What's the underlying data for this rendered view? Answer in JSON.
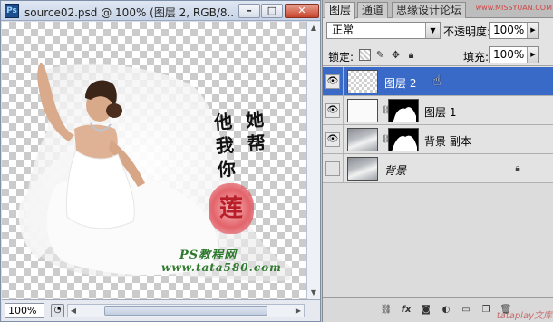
{
  "document": {
    "app_icon_text": "Ps",
    "title": "source02.psd @ 100% (图层 2, RGB/8...",
    "zoom_value": "100%"
  },
  "canvas_art": {
    "calligraphy_lines": [
      "他 她",
      "我 帮",
      "你"
    ],
    "seal_text": "莲",
    "brand_line": "PS教程网",
    "url_line": "www.tata580.com"
  },
  "panel": {
    "tabs": [
      {
        "label": "图层",
        "active": true
      },
      {
        "label": "通道",
        "active": false
      },
      {
        "label": "思缘设计论坛",
        "active": false
      }
    ],
    "top_watermark": "www.MISSYUAN.COM",
    "blend_mode": "正常",
    "opacity_label": "不透明度:",
    "opacity_value": "100%",
    "lock_label": "锁定:",
    "fill_label": "填充:",
    "fill_value": "100%",
    "layers": [
      {
        "name": "图层 2",
        "visible": true,
        "selected": true,
        "has_mask": false,
        "thumb": "trans"
      },
      {
        "name": "图层 1",
        "visible": true,
        "selected": false,
        "has_mask": true,
        "thumb": "whiteish"
      },
      {
        "name": "背景 副本",
        "visible": true,
        "selected": false,
        "has_mask": true,
        "thumb": "photo"
      },
      {
        "name": "背景",
        "visible": false,
        "selected": false,
        "has_mask": false,
        "thumb": "photo",
        "locked": true
      }
    ],
    "bottom_watermark": "tataplay文库"
  },
  "colors": {
    "selected_layer": "#3a6ac8",
    "close_button": "#c9442c",
    "seal_red": "#d8343b"
  }
}
